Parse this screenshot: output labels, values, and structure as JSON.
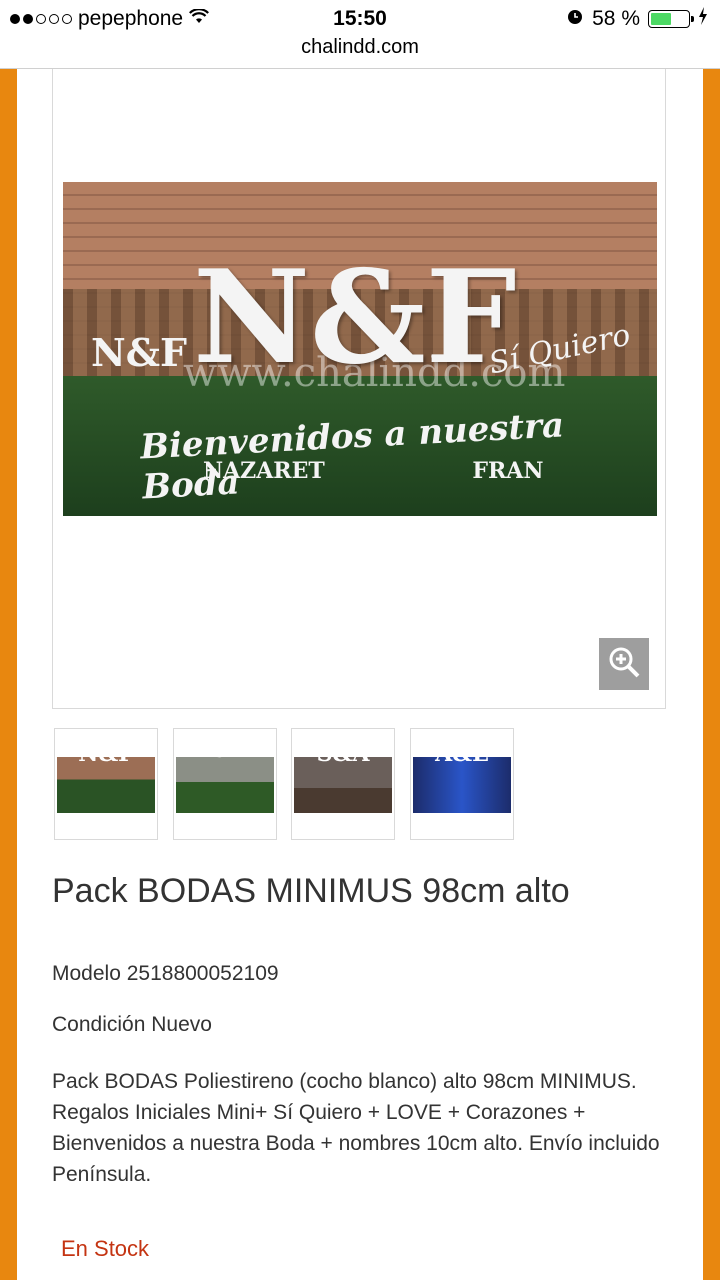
{
  "status_bar": {
    "carrier": "pepephone",
    "time": "15:50",
    "battery": "58 %",
    "battery_level": 0.58
  },
  "browser": {
    "url": "chalindd.com"
  },
  "product": {
    "image": {
      "big_letters": "N&F",
      "small_letters": "N&F",
      "si_quiero": "Sí Quiero",
      "welcome_text": "Bienvenidos a nuestra Boda",
      "names": "NAZARET FRAN",
      "watermark": "www.chalindd.com"
    },
    "thumbnails": [
      {
        "label": "N&F"
      },
      {
        "label": "L&M"
      },
      {
        "label": "S&A"
      },
      {
        "label": "A&E"
      }
    ],
    "title": "Pack BODAS MINIMUS 98cm alto",
    "model_label": "Modelo",
    "model_value": "2518800052109",
    "condition_label": "Condición",
    "condition_value": "Nuevo",
    "description": "Pack BODAS Poliestireno (cocho blanco) alto 98cm MINIMUS. Regalos Iniciales Mini+ Sí Quiero + LOVE + Corazones + Bienvenidos a nuestra Boda + nombres 10cm alto. Envío incluido Península.",
    "stock": "En Stock"
  },
  "colors": {
    "side_border": "#e8870f",
    "stock_text": "#c43412",
    "zoom_button": "#9e9e9e"
  }
}
